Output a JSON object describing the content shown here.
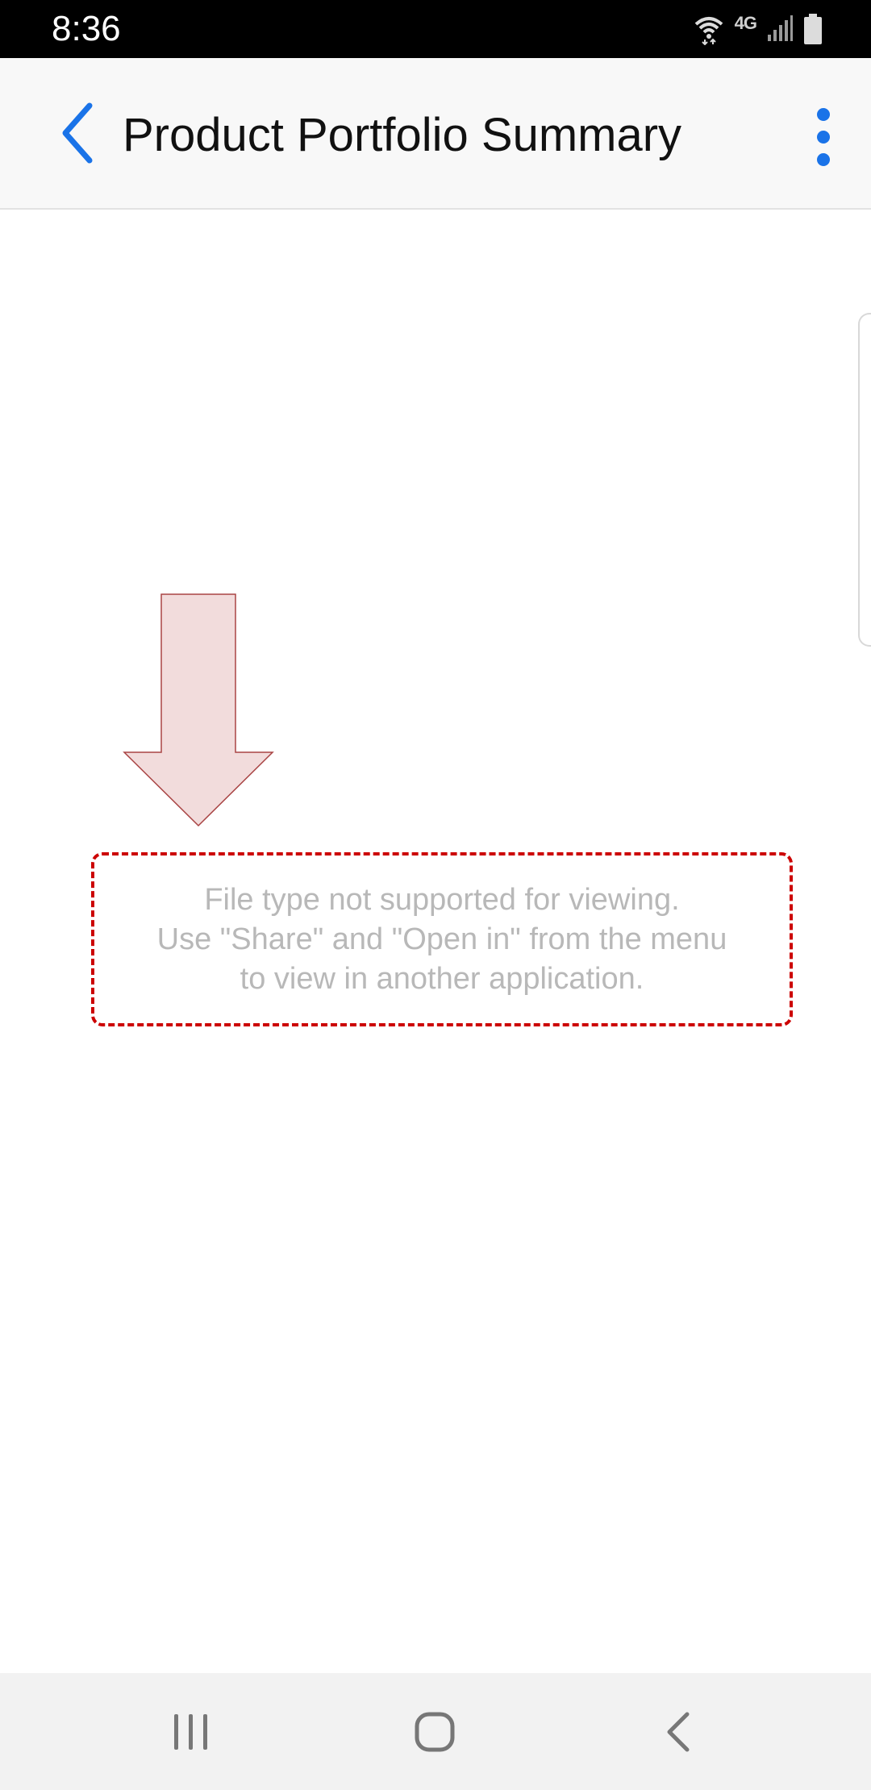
{
  "status_bar": {
    "time": "8:36",
    "network_label": "4G",
    "icons": [
      "wifi-icon",
      "signal-icon",
      "battery-icon"
    ]
  },
  "app_bar": {
    "title": "Product Portfolio Summary",
    "back_icon": "chevron-left-icon",
    "more_icon": "more-vertical-icon"
  },
  "content": {
    "message_lines": [
      "File type not supported for viewing.",
      "Use \"Share\" and \"Open in\" from the menu",
      "to view in another application."
    ]
  },
  "nav_bar": {
    "icons": [
      "recents-icon",
      "home-icon",
      "back-icon"
    ]
  },
  "colors": {
    "accent": "#1a73e8",
    "annotation_border": "#cc0000",
    "annotation_arrow_fill": "#f2dcdc",
    "message_text": "#b8b8b8",
    "app_bar_bg": "#f8f8f8",
    "nav_bar_bg": "#f2f2f2"
  }
}
